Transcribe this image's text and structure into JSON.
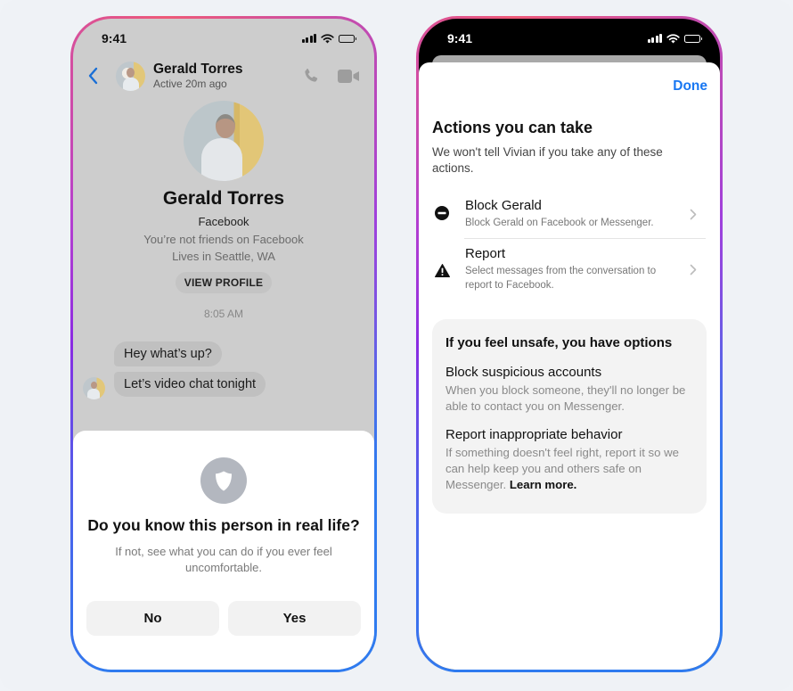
{
  "left_phone": {
    "status_bar": {
      "time": "9:41",
      "icons": [
        "signal-icon",
        "wifi-icon",
        "battery-icon"
      ]
    },
    "header": {
      "back_icon": "chevron-left-icon",
      "name": "Gerald Torres",
      "status": "Active 20m ago",
      "actions": [
        "phone-icon",
        "video-camera-icon"
      ]
    },
    "profile": {
      "name": "Gerald Torres",
      "source": "Facebook",
      "friend_status": "You’re not friends on Facebook",
      "location": "Lives in Seattle, WA",
      "view_profile_label": "VIEW PROFILE"
    },
    "conversation": {
      "timestamp": "8:05 AM",
      "messages": [
        "Hey what’s up?",
        "Let’s video chat tonight"
      ]
    },
    "prompt_sheet": {
      "icon": "shield-icon",
      "title": "Do you know this person in real life?",
      "description": "If not, see what you can do if you ever feel uncomfortable.",
      "buttons": {
        "no": "No",
        "yes": "Yes"
      }
    }
  },
  "right_phone": {
    "status_bar": {
      "time": "9:41",
      "icons": [
        "signal-icon",
        "wifi-icon",
        "battery-icon"
      ]
    },
    "done_label": "Done",
    "title": "Actions you can take",
    "description": "We won't tell Vivian if you take any of these actions.",
    "actions": [
      {
        "icon": "block-icon",
        "title": "Block Gerald",
        "subtitle": "Block Gerald on Facebook or Messenger."
      },
      {
        "icon": "warning-icon",
        "title": "Report",
        "subtitle": "Select messages from the conversation to report to Facebook."
      }
    ],
    "safety_card": {
      "title": "If you feel unsafe, you have options",
      "sections": [
        {
          "heading": "Block suspicious accounts",
          "text": "When you block someone, they'll no longer be able to contact you on Messenger."
        },
        {
          "heading": "Report inappropriate behavior",
          "text": "If something doesn't feel right, report it so we can help keep you and others safe on Messenger."
        }
      ],
      "learn_more": "Learn more."
    }
  },
  "colors": {
    "accent_blue": "#1877f2",
    "frame_gradient": [
      "#8a2be2",
      "#ee5a78",
      "#2f7bef"
    ],
    "dim_overlay": "#cdcdcd"
  }
}
